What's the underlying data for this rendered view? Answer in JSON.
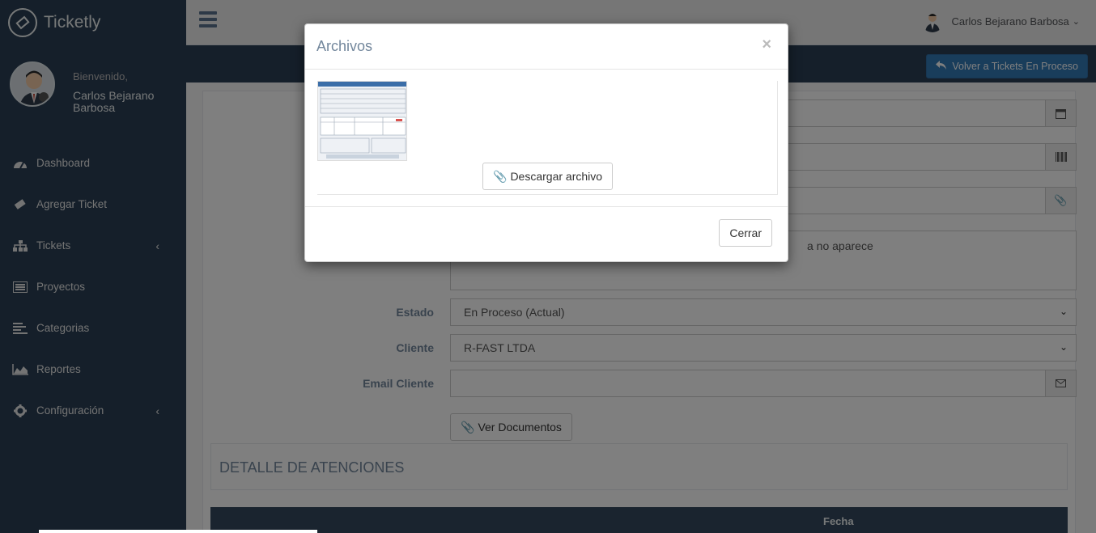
{
  "brand": {
    "name": "Ticketly",
    "logo_icon": "ticket-icon"
  },
  "profile": {
    "welcome": "Bienvenido,",
    "name": "Carlos Bejarano Barbosa"
  },
  "sidebar": {
    "items": [
      {
        "label": "Dashboard",
        "icon": "dashboard-icon"
      },
      {
        "label": "Agregar Ticket",
        "icon": "ticket-icon"
      },
      {
        "label": "Tickets",
        "icon": "sitemap-icon",
        "has_children": true
      },
      {
        "label": "Proyectos",
        "icon": "list-icon"
      },
      {
        "label": "Categorias",
        "icon": "align-left-icon"
      },
      {
        "label": "Reportes",
        "icon": "area-chart-icon"
      },
      {
        "label": "Configuración",
        "icon": "gear-icon",
        "has_children": true
      }
    ]
  },
  "topnav": {
    "user_name": "Carlos Bejarano Barbosa"
  },
  "header": {
    "back_button": "Volver a Tickets En Proceso"
  },
  "form": {
    "description_value": "a no aparece",
    "estado_label": "Estado",
    "estado_value": "En Proceso (Actual)",
    "cliente_label": "Cliente",
    "cliente_value": "R-FAST LTDA",
    "email_label": "Email Cliente",
    "email_value": "",
    "ver_documentos": "Ver Documentos"
  },
  "section": {
    "title": "DETALLE DE ATENCIONES"
  },
  "table": {
    "header_fecha": "Fecha"
  },
  "modal": {
    "title": "Archivos",
    "close_symbol": "×",
    "download_button": "Descargar archivo",
    "cerrar_button": "Cerrar"
  },
  "colors": {
    "sidebar_bg": "#2a3f54",
    "accent": "#337ab7",
    "label": "#73879c"
  }
}
